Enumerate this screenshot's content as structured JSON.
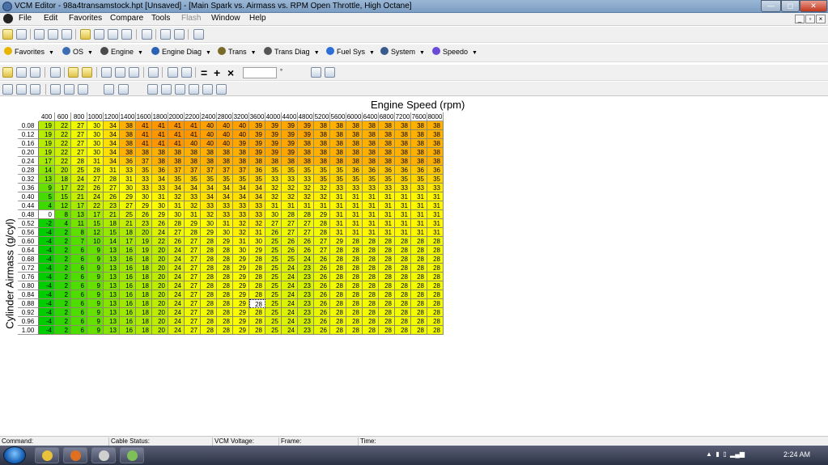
{
  "window": {
    "title": "VCM Editor - 98a4transamstock.hpt   [Unsaved] - [Main Spark vs. Airmass vs. RPM Open Throttle, High Octane]",
    "min_glyph": "—",
    "max_glyph": "◻",
    "close_glyph": "✕"
  },
  "menu": [
    {
      "label": "File",
      "enabled": true
    },
    {
      "label": "Edit",
      "enabled": true
    },
    {
      "label": "Favorites",
      "enabled": true
    },
    {
      "label": "Compare",
      "enabled": true
    },
    {
      "label": "Tools",
      "enabled": true
    },
    {
      "label": "Flash",
      "enabled": false
    },
    {
      "label": "Window",
      "enabled": true
    },
    {
      "label": "Help",
      "enabled": true
    }
  ],
  "mdi_controls": [
    "_",
    "▫",
    "×"
  ],
  "nav": [
    {
      "label": "Favorites",
      "icon": "star-icon",
      "color": "#e8b400"
    },
    {
      "label": "OS",
      "icon": "os-icon",
      "color": "#3b6db5"
    },
    {
      "label": "Engine",
      "icon": "engine-icon",
      "color": "#4a4a4a"
    },
    {
      "label": "Engine Diag",
      "icon": "engine-diag-icon",
      "color": "#2a62b3"
    },
    {
      "label": "Trans",
      "icon": "trans-icon",
      "color": "#7a6a2a"
    },
    {
      "label": "Trans Diag",
      "icon": "trans-diag-icon",
      "color": "#555555"
    },
    {
      "label": "Fuel Sys",
      "icon": "fuel-drop-icon",
      "color": "#2d6fd6"
    },
    {
      "label": "System",
      "icon": "system-icon",
      "color": "#3a5a8a"
    },
    {
      "label": "Speedo",
      "icon": "speedo-icon",
      "color": "#6a4ad6"
    }
  ],
  "table_toolbar": {
    "equals": "=",
    "plus": "+",
    "times": "×",
    "degree": "°",
    "zoom_value": ""
  },
  "axes": {
    "x_label": "Engine Speed (rpm)",
    "y_label": "Cylinder Airmass (g/cyl)",
    "x": [
      "400",
      "600",
      "800",
      "1000",
      "1200",
      "1400",
      "1600",
      "1800",
      "2000",
      "2200",
      "2400",
      "2800",
      "3200",
      "3600",
      "4000",
      "4400",
      "4800",
      "5200",
      "5600",
      "6000",
      "6400",
      "6800",
      "7200",
      "7600",
      "8000"
    ],
    "y": [
      "0.08",
      "0.12",
      "0.16",
      "0.20",
      "0.24",
      "0.28",
      "0.32",
      "0.36",
      "0.40",
      "0.44",
      "0.48",
      "0.52",
      "0.56",
      "0.60",
      "0.64",
      "0.68",
      "0.72",
      "0.76",
      "0.80",
      "0.84",
      "0.88",
      "0.92",
      "0.96",
      "1.00"
    ]
  },
  "table": {
    "selected": [
      20,
      13
    ],
    "rows": [
      [
        "19",
        "22",
        "27",
        "30",
        "34",
        "38",
        "41",
        "41",
        "41",
        "41",
        "40",
        "40",
        "40",
        "39",
        "39",
        "39",
        "39",
        "38",
        "38",
        "38",
        "38",
        "38",
        "38",
        "38",
        "38"
      ],
      [
        "19",
        "22",
        "27",
        "30",
        "34",
        "38",
        "41",
        "41",
        "41",
        "41",
        "40",
        "40",
        "40",
        "39",
        "39",
        "39",
        "39",
        "38",
        "38",
        "38",
        "38",
        "38",
        "38",
        "38",
        "38"
      ],
      [
        "19",
        "22",
        "27",
        "30",
        "34",
        "38",
        "41",
        "41",
        "41",
        "40",
        "40",
        "40",
        "39",
        "39",
        "39",
        "39",
        "38",
        "38",
        "38",
        "38",
        "38",
        "38",
        "38",
        "38",
        "38"
      ],
      [
        "19",
        "22",
        "27",
        "30",
        "34",
        "38",
        "38",
        "38",
        "38",
        "38",
        "38",
        "38",
        "38",
        "39",
        "39",
        "39",
        "38",
        "38",
        "38",
        "38",
        "38",
        "38",
        "38",
        "38",
        "38"
      ],
      [
        "17",
        "22",
        "28",
        "31",
        "34",
        "36",
        "37",
        "38",
        "38",
        "38",
        "38",
        "38",
        "38",
        "38",
        "38",
        "38",
        "38",
        "38",
        "38",
        "38",
        "38",
        "38",
        "38",
        "38",
        "38"
      ],
      [
        "14",
        "20",
        "25",
        "28",
        "31",
        "33",
        "35",
        "36",
        "37",
        "37",
        "37",
        "37",
        "37",
        "36",
        "35",
        "35",
        "35",
        "35",
        "35",
        "36",
        "36",
        "36",
        "36",
        "36",
        "36"
      ],
      [
        "13",
        "18",
        "24",
        "27",
        "28",
        "31",
        "33",
        "34",
        "35",
        "35",
        "35",
        "35",
        "35",
        "35",
        "33",
        "33",
        "33",
        "35",
        "35",
        "35",
        "35",
        "35",
        "35",
        "35",
        "35"
      ],
      [
        "9",
        "17",
        "22",
        "26",
        "27",
        "30",
        "33",
        "33",
        "34",
        "34",
        "34",
        "34",
        "34",
        "34",
        "32",
        "32",
        "32",
        "32",
        "33",
        "33",
        "33",
        "33",
        "33",
        "33",
        "33"
      ],
      [
        "5",
        "15",
        "21",
        "24",
        "26",
        "29",
        "30",
        "31",
        "32",
        "33",
        "34",
        "34",
        "34",
        "34",
        "32",
        "32",
        "32",
        "32",
        "31",
        "31",
        "31",
        "31",
        "31",
        "31",
        "31"
      ],
      [
        "4",
        "12",
        "17",
        "22",
        "23",
        "27",
        "29",
        "30",
        "31",
        "32",
        "33",
        "33",
        "33",
        "33",
        "31",
        "31",
        "31",
        "31",
        "31",
        "31",
        "31",
        "31",
        "31",
        "31",
        "31"
      ],
      [
        "0",
        "8",
        "13",
        "17",
        "21",
        "25",
        "26",
        "29",
        "30",
        "31",
        "32",
        "33",
        "33",
        "33",
        "30",
        "28",
        "28",
        "29",
        "31",
        "31",
        "31",
        "31",
        "31",
        "31",
        "31"
      ],
      [
        "-2",
        "4",
        "11",
        "15",
        "18",
        "21",
        "23",
        "26",
        "28",
        "29",
        "30",
        "31",
        "32",
        "32",
        "27",
        "27",
        "27",
        "28",
        "31",
        "31",
        "31",
        "31",
        "31",
        "31",
        "31"
      ],
      [
        "-4",
        "2",
        "8",
        "12",
        "15",
        "18",
        "20",
        "24",
        "27",
        "28",
        "29",
        "30",
        "32",
        "31",
        "26",
        "27",
        "27",
        "28",
        "31",
        "31",
        "31",
        "31",
        "31",
        "31",
        "31"
      ],
      [
        "-4",
        "2",
        "7",
        "10",
        "14",
        "17",
        "19",
        "22",
        "26",
        "27",
        "28",
        "29",
        "31",
        "30",
        "25",
        "26",
        "26",
        "27",
        "29",
        "28",
        "28",
        "28",
        "28",
        "28",
        "28"
      ],
      [
        "-4",
        "2",
        "6",
        "9",
        "13",
        "16",
        "19",
        "20",
        "24",
        "27",
        "28",
        "28",
        "30",
        "29",
        "25",
        "26",
        "26",
        "27",
        "28",
        "28",
        "28",
        "28",
        "28",
        "28",
        "28"
      ],
      [
        "-4",
        "2",
        "6",
        "9",
        "13",
        "16",
        "18",
        "20",
        "24",
        "27",
        "28",
        "28",
        "29",
        "28",
        "25",
        "25",
        "24",
        "26",
        "28",
        "28",
        "28",
        "28",
        "28",
        "28",
        "28"
      ],
      [
        "-4",
        "2",
        "6",
        "9",
        "13",
        "16",
        "18",
        "20",
        "24",
        "27",
        "28",
        "28",
        "29",
        "28",
        "25",
        "24",
        "23",
        "26",
        "28",
        "28",
        "28",
        "28",
        "28",
        "28",
        "28"
      ],
      [
        "-4",
        "2",
        "6",
        "9",
        "13",
        "16",
        "18",
        "20",
        "24",
        "27",
        "28",
        "28",
        "29",
        "28",
        "25",
        "24",
        "23",
        "26",
        "28",
        "28",
        "28",
        "28",
        "28",
        "28",
        "28"
      ],
      [
        "-4",
        "2",
        "6",
        "9",
        "13",
        "16",
        "18",
        "20",
        "24",
        "27",
        "28",
        "28",
        "29",
        "28",
        "25",
        "24",
        "23",
        "26",
        "28",
        "28",
        "28",
        "28",
        "28",
        "28",
        "28"
      ],
      [
        "-4",
        "2",
        "6",
        "9",
        "13",
        "16",
        "18",
        "20",
        "24",
        "27",
        "28",
        "28",
        "29",
        "28",
        "25",
        "24",
        "23",
        "26",
        "28",
        "28",
        "28",
        "28",
        "28",
        "28",
        "28"
      ],
      [
        "-4",
        "2",
        "6",
        "9",
        "13",
        "16",
        "18",
        "20",
        "24",
        "27",
        "28",
        "28",
        "29",
        "28",
        "25",
        "24",
        "23",
        "26",
        "28",
        "28",
        "28",
        "28",
        "28",
        "28",
        "28"
      ],
      [
        "-4",
        "2",
        "6",
        "9",
        "13",
        "16",
        "18",
        "20",
        "24",
        "27",
        "28",
        "28",
        "29",
        "28",
        "25",
        "24",
        "23",
        "26",
        "28",
        "28",
        "28",
        "28",
        "28",
        "28",
        "28"
      ],
      [
        "-4",
        "2",
        "6",
        "9",
        "13",
        "16",
        "18",
        "20",
        "24",
        "27",
        "28",
        "28",
        "29",
        "28",
        "25",
        "24",
        "23",
        "26",
        "28",
        "28",
        "28",
        "28",
        "28",
        "28",
        "28"
      ],
      [
        "-4",
        "2",
        "6",
        "9",
        "13",
        "16",
        "18",
        "20",
        "24",
        "27",
        "28",
        "28",
        "29",
        "28",
        "25",
        "24",
        "23",
        "26",
        "28",
        "28",
        "28",
        "28",
        "28",
        "28",
        "28"
      ]
    ]
  },
  "status": [
    {
      "label": "Command:"
    },
    {
      "label": "Cable Status:"
    },
    {
      "label": "VCM Voltage:"
    },
    {
      "label": "Frame:"
    },
    {
      "label": "Time:"
    }
  ],
  "taskbar": {
    "clock": "2:24 AM",
    "apps": [
      {
        "name": "explorer",
        "color": "#e8c23a"
      },
      {
        "name": "firefox",
        "color": "#e07020"
      },
      {
        "name": "tools",
        "color": "#cfcfcf"
      },
      {
        "name": "vcm-editor",
        "color": "#7fbf5a"
      }
    ]
  }
}
